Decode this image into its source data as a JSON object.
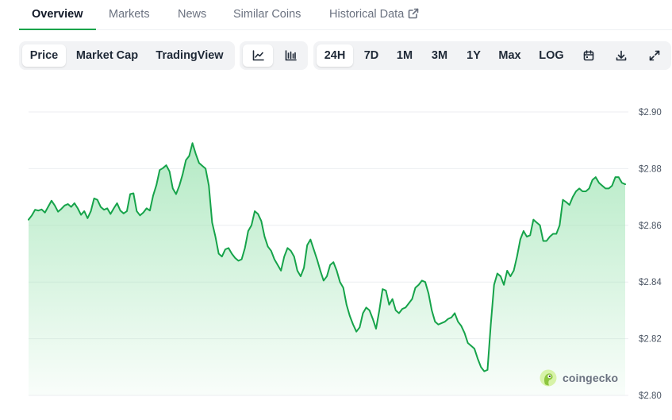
{
  "tabs": {
    "overview": "Overview",
    "markets": "Markets",
    "news": "News",
    "similar_coins": "Similar Coins",
    "historical_data": "Historical Data"
  },
  "chart_type_tabs": {
    "price": "Price",
    "market_cap": "Market Cap",
    "tradingview": "TradingView",
    "selected": "Price"
  },
  "view_icons": [
    "line-chart-icon",
    "candlestick-chart-icon"
  ],
  "ranges": {
    "r24h": "24H",
    "r7d": "7D",
    "r1m": "1M",
    "r3m": "3M",
    "r1y": "1Y",
    "max": "Max",
    "log": "LOG",
    "selected": "24H"
  },
  "tool_icons": [
    "calendar-icon",
    "download-icon",
    "expand-icon"
  ],
  "watermark": "coingecko",
  "colors": {
    "accent": "#16a34a",
    "line": "#16a34a",
    "fill_top": "#9be3b1",
    "grid": "#eceef1"
  },
  "chart_data": {
    "type": "area",
    "title": "",
    "xlabel": "",
    "ylabel": "",
    "ylim": [
      2.8,
      2.9
    ],
    "yticks": [
      "$2.90",
      "$2.88",
      "$2.86",
      "$2.84",
      "$2.82",
      "$2.80"
    ],
    "ytick_values": [
      2.9,
      2.88,
      2.86,
      2.84,
      2.82,
      2.8
    ],
    "y_axis_side": "right",
    "grid": true,
    "series": [
      {
        "values": [
          2.862,
          2.8635,
          2.8655,
          2.8652,
          2.8656,
          2.8645,
          2.8666,
          2.8687,
          2.867,
          2.8648,
          2.8658,
          2.867,
          2.8675,
          2.8665,
          2.8678,
          2.866,
          2.8637,
          2.865,
          2.8625,
          2.865,
          2.8695,
          2.869,
          2.8665,
          2.8655,
          2.866,
          2.864,
          2.866,
          2.8678,
          2.8652,
          2.8642,
          2.865,
          2.871,
          2.8713,
          2.865,
          2.8635,
          2.8645,
          2.866,
          2.8652,
          2.8705,
          2.8742,
          2.8795,
          2.8802,
          2.8812,
          2.879,
          2.873,
          2.871,
          2.874,
          2.878,
          2.883,
          2.8845,
          2.889,
          2.8852,
          2.882,
          2.881,
          2.88,
          2.874,
          2.861,
          2.856,
          2.85,
          2.849,
          2.8515,
          2.852,
          2.85,
          2.8485,
          2.8475,
          2.848,
          2.852,
          2.858,
          2.86,
          2.865,
          2.864,
          2.8615,
          2.856,
          2.8525,
          2.851,
          2.848,
          2.846,
          2.844,
          2.849,
          2.852,
          2.851,
          2.849,
          2.844,
          2.842,
          2.845,
          2.853,
          2.855,
          2.8515,
          2.848,
          2.844,
          2.8405,
          2.842,
          2.846,
          2.847,
          2.844,
          2.84,
          2.838,
          2.832,
          2.828,
          2.825,
          2.8225,
          2.824,
          2.829,
          2.831,
          2.83,
          2.827,
          2.8235,
          2.83,
          2.8375,
          2.837,
          2.832,
          2.834,
          2.83,
          2.829,
          2.8305,
          2.831,
          2.8325,
          2.834,
          2.838,
          2.839,
          2.8405,
          2.84,
          2.836,
          2.83,
          2.826,
          2.825,
          2.8255,
          2.826,
          2.827,
          2.8275,
          2.829,
          2.826,
          2.8245,
          2.822,
          2.8185,
          2.8175,
          2.8165,
          2.813,
          2.81,
          2.8085,
          2.809,
          2.825,
          2.839,
          2.843,
          2.842,
          2.839,
          2.844,
          2.842,
          2.844,
          2.849,
          2.855,
          2.858,
          2.856,
          2.8565,
          2.862,
          2.861,
          2.86,
          2.8545,
          2.8545,
          2.856,
          2.857,
          2.857,
          2.86,
          2.869,
          2.8682,
          2.8672,
          2.87,
          2.872,
          2.873,
          2.872,
          2.872,
          2.873,
          2.876,
          2.877,
          2.875,
          2.874,
          2.873,
          2.873,
          2.874,
          2.877,
          2.877,
          2.875,
          2.8745
        ]
      }
    ]
  }
}
